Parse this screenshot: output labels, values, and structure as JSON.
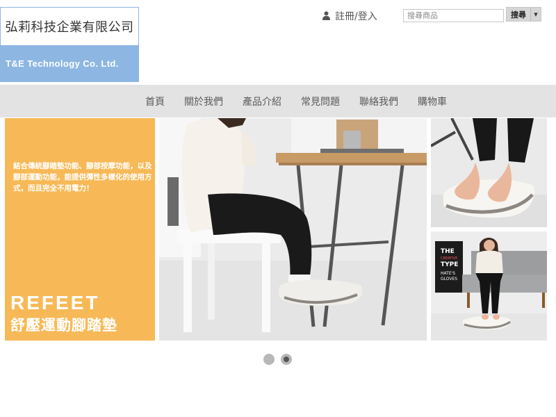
{
  "logo": {
    "company_cn": "弘莉科技企業有限公司",
    "company_en": "T&E Technology Co. Ltd."
  },
  "header": {
    "user_link": "註冊/登入",
    "user_icon": "user-icon",
    "search_placeholder": "搜尋商品",
    "search_button": "搜尋",
    "search_caret": "▼"
  },
  "nav": {
    "items": [
      "首頁",
      "關於我們",
      "產品介紹",
      "常見問題",
      "聯絡我們",
      "購物車"
    ]
  },
  "banner": {
    "description": "結合傳統腳踏墊功能、腳部按摩功能，以及腳部運動功能，能提供彈性多樣化的使用方式，而且完全不用電力！",
    "title_en": "REFEET",
    "title_cn": "舒壓運動腳踏墊",
    "poster_lines": [
      "THE",
      "CREATIVE",
      "TYPE",
      "HATE'S",
      "GLOVES"
    ],
    "accent_color": "#f7b957"
  },
  "carousel": {
    "dot_count": 2,
    "active_index": 1
  }
}
